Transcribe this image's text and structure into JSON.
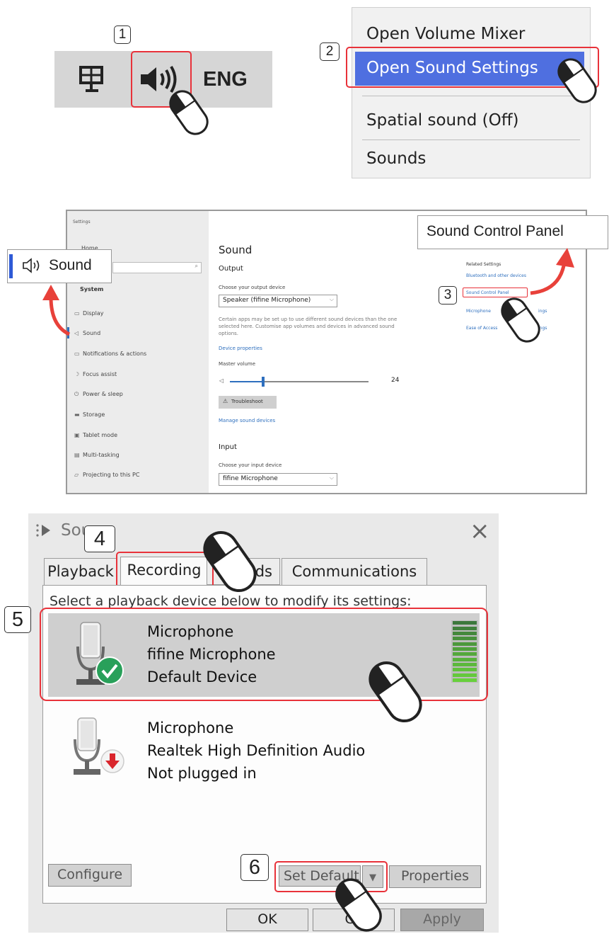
{
  "steps": {
    "s1": "1",
    "s2": "2",
    "s3": "3",
    "s4": "4",
    "s5": "5",
    "s6": "6"
  },
  "taskbar": {
    "lang": "ENG",
    "monitor_icon": "monitor-icon",
    "speaker_icon": "speaker-icon"
  },
  "context_menu": {
    "items": [
      "Open Volume Mixer",
      "Open Sound  Settings",
      "Spatial sound (Off)",
      "Sounds"
    ]
  },
  "callouts": {
    "sound_label": "Sound",
    "sound_control_panel": "Sound Control Panel"
  },
  "settings": {
    "window_title": "Settings",
    "home": "Home",
    "system": "System",
    "nav": [
      "Display",
      "Sound",
      "Notifications & actions",
      "Focus assist",
      "Power & sleep",
      "Storage",
      "Tablet mode",
      "Multi-tasking",
      "Projecting to this PC"
    ],
    "page_title": "Sound",
    "output_heading": "Output",
    "choose_output": "Choose your output device",
    "output_device": "Speaker (fifine Microphone)",
    "output_note": "Certain apps may be set up to use different sound devices than the one selected here. Customise app volumes and devices in advanced sound options.",
    "device_properties": "Device properties",
    "master_volume": "Master volume",
    "volume_value": "24",
    "volume_level": 0.24,
    "troubleshoot": "Troubleshoot",
    "manage_devices": "Manage sound devices",
    "input_heading": "Input",
    "choose_input": "Choose your input device",
    "input_device": "fifine Microphone",
    "related_heading": "Related Settings",
    "related_links": [
      "Bluetooth and other devices",
      "Sound Control Panel",
      "Microphone privacy settings",
      "Ease of Access audio settings"
    ],
    "related_visible": [
      "Bluetooth and other devices",
      "Sound Control Panel",
      "Microphone",
      "ings",
      "Ease of Access",
      "ings"
    ]
  },
  "dialog": {
    "title": "Sou",
    "close": "×",
    "tabs": [
      "Playback",
      "Recording",
      "nds",
      "Communications"
    ],
    "instruction": "Select a playback device below to modify its settings:",
    "devices": [
      {
        "name": "Microphone",
        "model": "fifine Microphone",
        "status": "Default Device",
        "badge": "check"
      },
      {
        "name": "Microphone",
        "model": "Realtek High Definition Audio",
        "status": "Not plugged in",
        "badge": "unplugged"
      }
    ],
    "buttons": {
      "configure": "Configure",
      "set_default": "Set Default",
      "properties": "Properties",
      "ok": "OK",
      "cancel": "Ca",
      "apply": "Apply"
    }
  },
  "colors": {
    "highlight": "#4f6fe0",
    "redbox": "#e8323a",
    "arrow": "#e8413a",
    "link": "#2e6fbe",
    "check": "#29a05a"
  }
}
